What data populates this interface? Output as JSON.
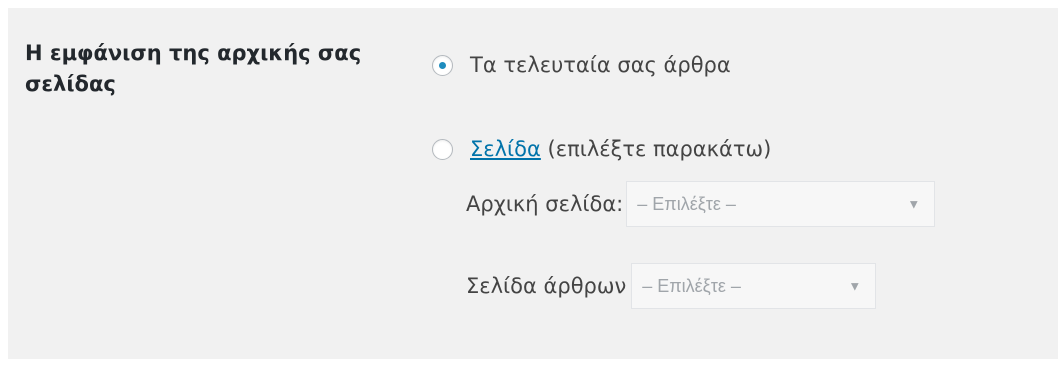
{
  "setting": {
    "label": "Η εμφάνιση της αρχικής σας σελίδας"
  },
  "options": {
    "latest_posts": {
      "label": "Τα τελευταία σας άρθρα",
      "checked": true
    },
    "static_page": {
      "link_text": "Σελίδα",
      "suffix": " (επιλέξτε παρακάτω)",
      "checked": false
    }
  },
  "front_page": {
    "label": "Αρχική σελίδα:",
    "selected": "– Επιλέξτε –"
  },
  "posts_page": {
    "label": "Σελίδα άρθρων",
    "selected": "– Επιλέξτε –"
  },
  "colors": {
    "panel_bg": "#f1f1f1",
    "radio_dot": "#1e8cbe",
    "link": "#0073aa"
  },
  "icons": {
    "select_caret": "chevron-down-icon"
  }
}
